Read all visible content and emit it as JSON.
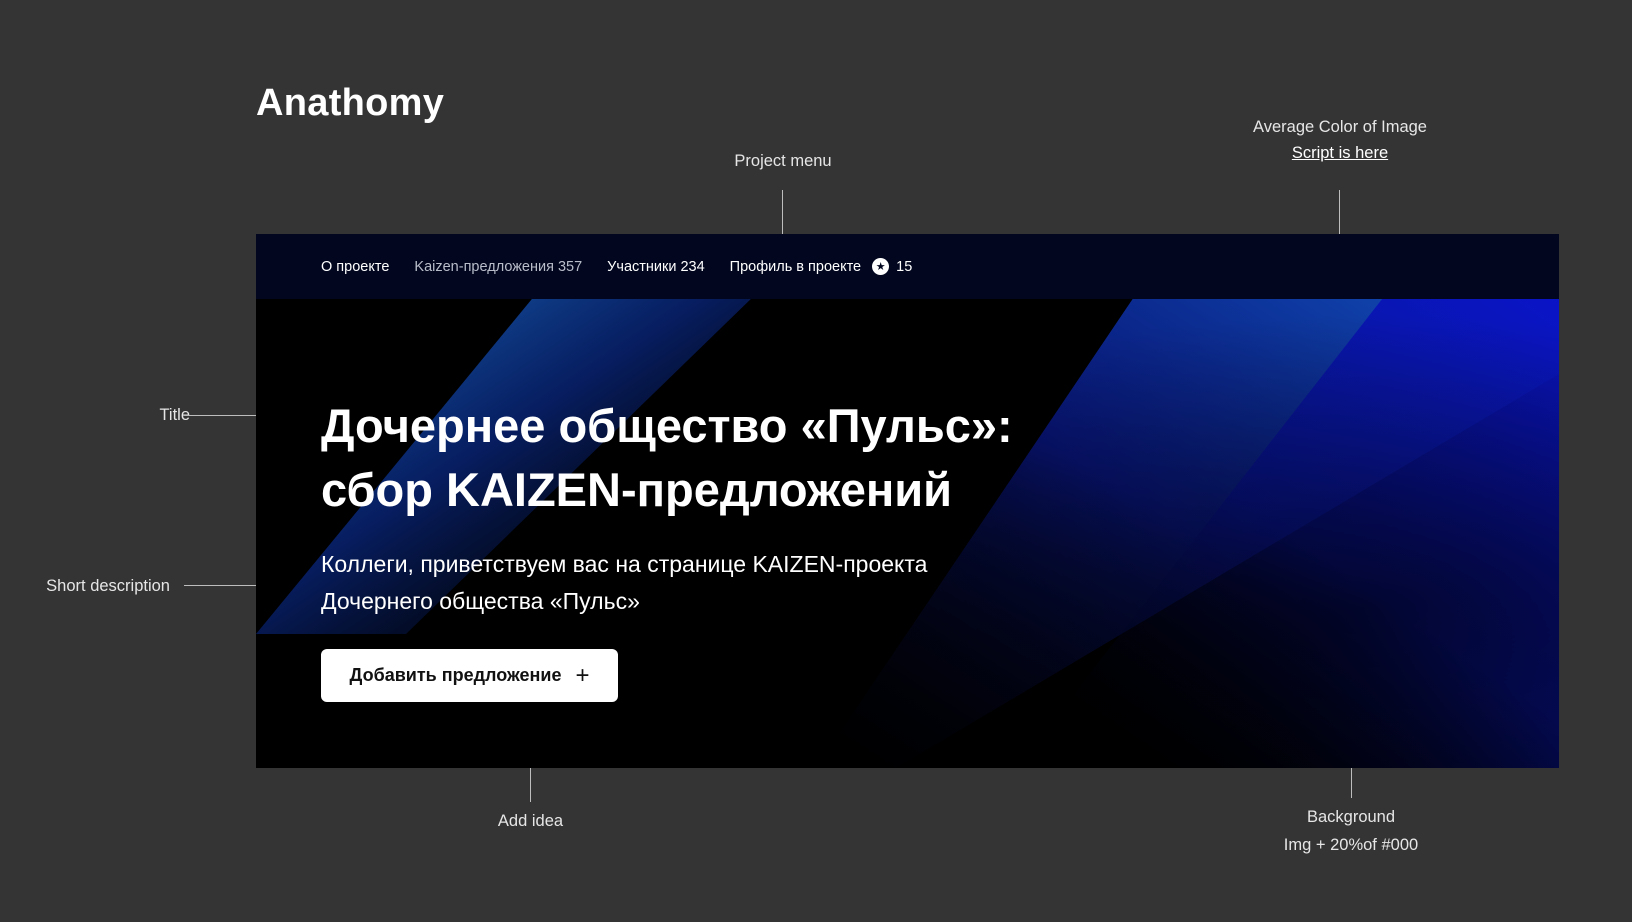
{
  "page": {
    "title": "Anathomy"
  },
  "annotations": {
    "project_menu": "Project menu",
    "average_color_line1": "Average Color of Image",
    "average_color_link": "Script is here",
    "title": "Title",
    "short_description": "Short description",
    "add_idea": "Add idea",
    "background_line1": "Background",
    "background_line2": "Img + 20%of #000"
  },
  "hero": {
    "nav": {
      "about": "О проекте",
      "kaizen": "Kaizen-предложения 357",
      "participants": "Участники 234",
      "profile": "Профиль в проекте",
      "star_icon": "star-icon",
      "star_count": "15"
    },
    "title_line1": "Дочернее общество «Пульс»:",
    "title_line2": "сбор KAIZEN-предложений",
    "description_line1": "Коллеги, приветствуем вас на странице KAIZEN-проекта",
    "description_line2": "Дочернего общества «Пульс»",
    "add_button_label": "Добавить предложение",
    "add_button_icon": "+"
  },
  "colors": {
    "canvas": "#343434",
    "nav_background": "#02071f",
    "hero_background": "#000000",
    "accent_blue": "#0b18b8",
    "button_background": "#ffffff"
  }
}
